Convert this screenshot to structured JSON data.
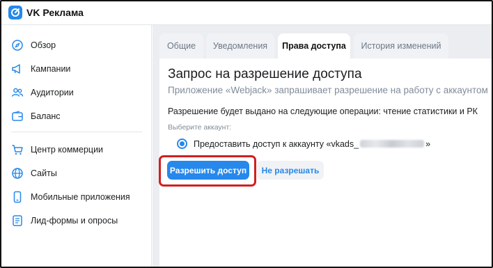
{
  "app": {
    "brand": "VK Реклама",
    "accent_color": "#2688eb",
    "highlight_color": "#d11f1f"
  },
  "sidebar": {
    "items": [
      {
        "label": "Обзор",
        "icon": "compass-icon"
      },
      {
        "label": "Кампании",
        "icon": "megaphone-icon"
      },
      {
        "label": "Аудитории",
        "icon": "users-icon"
      },
      {
        "label": "Баланс",
        "icon": "wallet-icon"
      },
      {
        "label": "Центр коммерции",
        "icon": "cart-icon"
      },
      {
        "label": "Сайты",
        "icon": "globe-icon"
      },
      {
        "label": "Мобильные приложения",
        "icon": "mobile-icon"
      },
      {
        "label": "Лид-формы и опросы",
        "icon": "form-icon"
      }
    ]
  },
  "tabs": [
    {
      "label": "Общие",
      "active": false
    },
    {
      "label": "Уведомления",
      "active": false
    },
    {
      "label": "Права доступа",
      "active": true
    },
    {
      "label": "История изменений",
      "active": false
    }
  ],
  "request": {
    "title": "Запрос на разрешение доступа",
    "subtitle": "Приложение «Webjack» запрашивает разрешение на работу с аккаунтом",
    "operations": "Разрешение будет выдано на следующие операции: чтение статистики и РК",
    "select_label": "Выберите аккаунт:",
    "account_prefix": "Предоставить доступ к аккаунту «vkads_",
    "account_suffix": "»",
    "allow_button": "Разрешить доступ",
    "deny_button": "Не разрешать"
  }
}
